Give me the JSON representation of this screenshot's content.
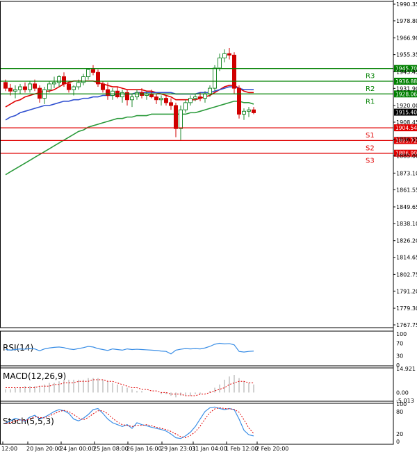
{
  "chart_data": {
    "type": "candlestick",
    "price_axis": {
      "ticks": [
        "1990.35",
        "1978.80",
        "1966.90",
        "1955.35",
        "1943.45",
        "1931.90",
        "1920.00",
        "1908.45",
        "1896.55",
        "1885.00",
        "1873.10",
        "1861.55",
        "1849.65",
        "1838.10",
        "1826.20",
        "1814.65",
        "1802.75",
        "1791.20",
        "1779.30",
        "1767.75"
      ],
      "range": [
        1767.75,
        1990.35
      ]
    },
    "time_axis": {
      "ticks": [
        "12:00",
        "20 Jan 20:00",
        "24 Jan 00:00",
        "25 Jan 08:00",
        "26 Jan 16:00",
        "29 Jan 23:01",
        "31 Jan 04:00",
        "1 Feb 12:00",
        "2 Feb 20:00"
      ]
    },
    "current_price": "1915.40",
    "levels": [
      {
        "label": "R3",
        "value": 1945.7,
        "tag": "1945.70",
        "color": "#008000"
      },
      {
        "label": "R2",
        "value": 1936.88,
        "tag": "1936.88",
        "color": "#008000"
      },
      {
        "label": "R1",
        "value": 1928.06,
        "tag": "1928.06",
        "color": "#008000"
      },
      {
        "label": "S1",
        "value": 1904.54,
        "tag": "1904.54",
        "color": "#e00000"
      },
      {
        "label": "S2",
        "value": 1895.72,
        "tag": "1895.72",
        "color": "#e00000"
      },
      {
        "label": "S3",
        "value": 1886.9,
        "tag": "1886.90",
        "color": "#e00000"
      }
    ],
    "candles": [
      [
        1936,
        1938,
        1930,
        1932
      ],
      [
        1932,
        1935,
        1927,
        1930
      ],
      [
        1930,
        1934,
        1925,
        1931
      ],
      [
        1931,
        1935,
        1928,
        1933
      ],
      [
        1933,
        1936,
        1929,
        1931
      ],
      [
        1931,
        1937,
        1929,
        1935
      ],
      [
        1935,
        1938,
        1930,
        1932
      ],
      [
        1932,
        1934,
        1922,
        1925
      ],
      [
        1925,
        1933,
        1921,
        1931
      ],
      [
        1931,
        1937,
        1929,
        1935
      ],
      [
        1935,
        1940,
        1932,
        1936
      ],
      [
        1936,
        1941,
        1933,
        1940
      ],
      [
        1940,
        1943,
        1933,
        1935
      ],
      [
        1935,
        1937,
        1929,
        1931
      ],
      [
        1931,
        1934,
        1927,
        1933
      ],
      [
        1933,
        1938,
        1931,
        1936
      ],
      [
        1936,
        1942,
        1934,
        1940
      ],
      [
        1940,
        1946,
        1938,
        1945
      ],
      [
        1945,
        1948,
        1941,
        1943
      ],
      [
        1943,
        1945,
        1933,
        1935
      ],
      [
        1935,
        1937,
        1929,
        1931
      ],
      [
        1931,
        1936,
        1924,
        1927
      ],
      [
        1927,
        1932,
        1924,
        1930
      ],
      [
        1930,
        1933,
        1925,
        1926
      ],
      [
        1926,
        1931,
        1922,
        1929
      ],
      [
        1929,
        1931,
        1920,
        1924
      ],
      [
        1924,
        1928,
        1919,
        1926
      ],
      [
        1926,
        1931,
        1924,
        1929
      ],
      [
        1929,
        1932,
        1925,
        1927
      ],
      [
        1927,
        1930,
        1924,
        1928
      ],
      [
        1928,
        1931,
        1925,
        1926
      ],
      [
        1926,
        1928,
        1921,
        1924
      ],
      [
        1924,
        1927,
        1920,
        1925
      ],
      [
        1925,
        1927,
        1920,
        1922
      ],
      [
        1922,
        1925,
        1917,
        1920
      ],
      [
        1920,
        1922,
        1898,
        1904
      ],
      [
        1904,
        1920,
        1896,
        1917
      ],
      [
        1917,
        1924,
        1915,
        1922
      ],
      [
        1922,
        1927,
        1920,
        1925
      ],
      [
        1925,
        1928,
        1923,
        1926
      ],
      [
        1926,
        1929,
        1923,
        1925
      ],
      [
        1925,
        1930,
        1922,
        1928
      ],
      [
        1928,
        1934,
        1926,
        1932
      ],
      [
        1932,
        1948,
        1930,
        1946
      ],
      [
        1946,
        1956,
        1944,
        1953
      ],
      [
        1953,
        1959,
        1950,
        1956
      ],
      [
        1956,
        1960,
        1952,
        1955
      ],
      [
        1955,
        1957,
        1928,
        1932
      ],
      [
        1932,
        1934,
        1911,
        1914
      ],
      [
        1914,
        1918,
        1910,
        1916
      ],
      [
        1916,
        1919,
        1912,
        1917
      ],
      [
        1917,
        1919,
        1914,
        1915
      ]
    ],
    "ma_series": [
      {
        "color": "#e00000",
        "values": [
          1919,
          1921,
          1923,
          1924,
          1926,
          1927,
          1928,
          1929,
          1930,
          1930,
          1931,
          1933,
          1935,
          1936,
          1937,
          1937,
          1937,
          1937,
          1937,
          1936,
          1935,
          1934,
          1933,
          1933,
          1932,
          1931,
          1931,
          1931,
          1931,
          1930,
          1930,
          1929,
          1928,
          1927,
          1926,
          1924,
          1924,
          1924,
          1924,
          1924,
          1925,
          1926,
          1927,
          1929,
          1931,
          1933,
          1934,
          1934,
          1932,
          1930,
          1929,
          1929
        ]
      },
      {
        "color": "#3050d0",
        "values": [
          1910,
          1912,
          1913,
          1915,
          1916,
          1917,
          1918,
          1919,
          1920,
          1920,
          1921,
          1922,
          1923,
          1923,
          1924,
          1924,
          1925,
          1925,
          1926,
          1926,
          1927,
          1927,
          1927,
          1928,
          1928,
          1928,
          1928,
          1929,
          1929,
          1929,
          1929,
          1929,
          1929,
          1929,
          1929,
          1928,
          1928,
          1928,
          1928,
          1928,
          1929,
          1929,
          1929,
          1930,
          1931,
          1932,
          1933,
          1933,
          1932,
          1931,
          1931,
          1931
        ]
      },
      {
        "color": "#2a9a3a",
        "values": [
          1872,
          1874,
          1876,
          1878,
          1880,
          1882,
          1884,
          1886,
          1888,
          1890,
          1892,
          1894,
          1896,
          1898,
          1900,
          1902,
          1903,
          1905,
          1906,
          1907,
          1908,
          1909,
          1910,
          1911,
          1911,
          1912,
          1912,
          1913,
          1913,
          1913,
          1914,
          1914,
          1914,
          1914,
          1914,
          1914,
          1914,
          1914,
          1915,
          1915,
          1916,
          1917,
          1918,
          1919,
          1920,
          1921,
          1922,
          1923,
          1923,
          1922,
          1922,
          1921
        ]
      }
    ],
    "rsi": {
      "label": "RSI(14)",
      "ticks": [
        "100",
        "70",
        "30",
        "0"
      ],
      "values": [
        50,
        48,
        50,
        52,
        51,
        53,
        52,
        46,
        52,
        55,
        57,
        58,
        56,
        52,
        50,
        53,
        56,
        60,
        58,
        53,
        50,
        47,
        52,
        50,
        48,
        52,
        50,
        51,
        50,
        49,
        48,
        47,
        45,
        44,
        36,
        48,
        51,
        53,
        52,
        53,
        52,
        55,
        60,
        67,
        70,
        68,
        69,
        65,
        44,
        42,
        44,
        45
      ]
    },
    "macd": {
      "label": "MACD(12,26,9)",
      "ticks": [
        "14.921",
        "0.00",
        "-5.013"
      ],
      "hist": [
        2,
        2,
        3,
        3,
        4,
        4,
        4,
        4,
        5,
        6,
        6,
        7,
        8,
        8,
        8,
        8,
        8,
        9,
        9,
        9,
        8,
        7,
        6,
        5,
        4,
        3,
        2,
        1,
        1,
        0,
        0,
        0,
        -1,
        -1,
        -2,
        -3,
        -2,
        -2,
        -2,
        -1,
        -1,
        0,
        1,
        3,
        5,
        8,
        10,
        11,
        9,
        7,
        6,
        5
      ],
      "signal": [
        3,
        3,
        3,
        3,
        3,
        3,
        3,
        4,
        4,
        4,
        5,
        5,
        6,
        6,
        6,
        7,
        7,
        7,
        8,
        8,
        8,
        7,
        7,
        6,
        5,
        4,
        3,
        3,
        2,
        2,
        1,
        1,
        0,
        0,
        -1,
        -1,
        -1,
        -2,
        -2,
        -2,
        -1,
        -1,
        0,
        1,
        2,
        3,
        5,
        6,
        7,
        7,
        6,
        6
      ]
    },
    "stoch": {
      "label": "Stoch(5,5,3)",
      "ticks": [
        "100",
        "80",
        "20",
        "0"
      ],
      "k": [
        50,
        55,
        62,
        58,
        54,
        65,
        70,
        60,
        65,
        72,
        80,
        85,
        82,
        75,
        60,
        55,
        62,
        72,
        85,
        88,
        75,
        60,
        50,
        45,
        40,
        45,
        35,
        50,
        45,
        42,
        38,
        35,
        32,
        28,
        20,
        10,
        8,
        15,
        25,
        40,
        60,
        80,
        90,
        92,
        88,
        85,
        88,
        85,
        60,
        30,
        18,
        15
      ],
      "d": [
        48,
        50,
        55,
        58,
        56,
        60,
        66,
        64,
        63,
        68,
        74,
        80,
        83,
        80,
        72,
        63,
        58,
        64,
        74,
        82,
        82,
        74,
        62,
        52,
        45,
        43,
        40,
        43,
        43,
        45,
        42,
        38,
        35,
        32,
        27,
        20,
        13,
        10,
        16,
        26,
        41,
        60,
        77,
        87,
        90,
        88,
        87,
        86,
        78,
        58,
        36,
        21
      ]
    }
  }
}
